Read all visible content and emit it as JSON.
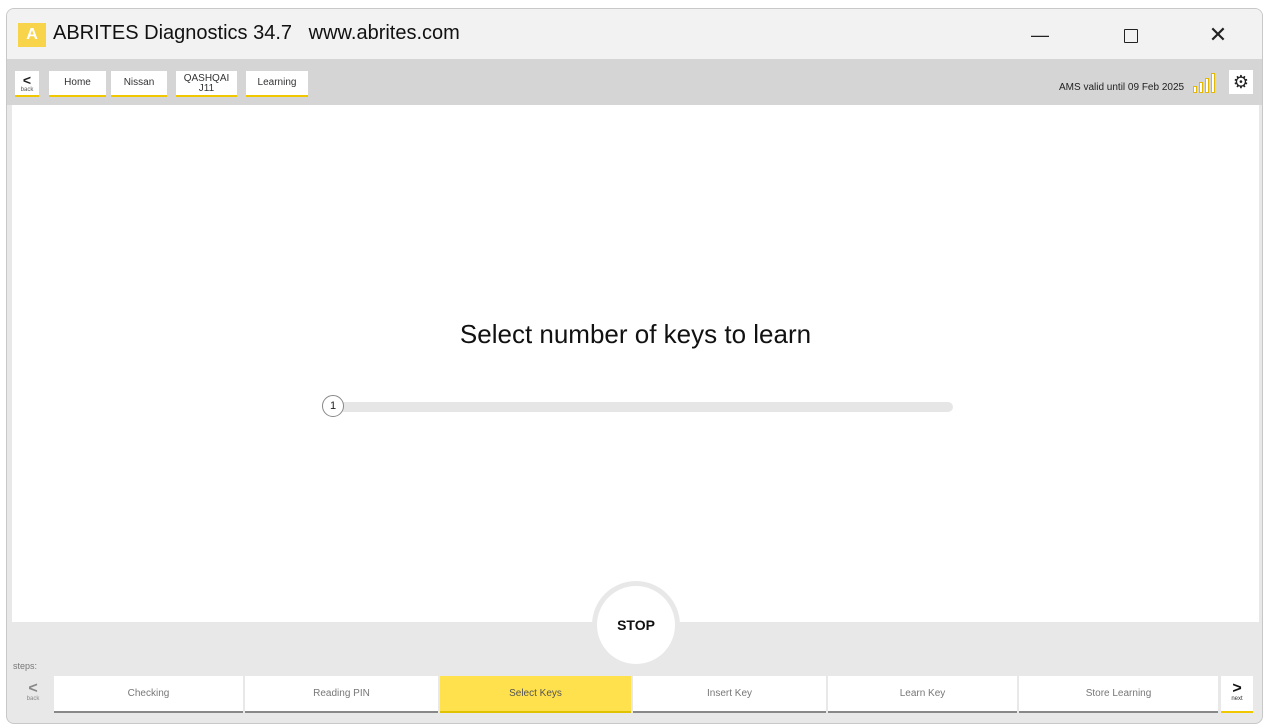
{
  "window": {
    "logo_letter": "A",
    "title": "ABRITES Diagnostics 34.7   www.abrites.com",
    "minimize_glyph": "—",
    "close_glyph": "✕"
  },
  "nav": {
    "back_glyph": "<",
    "back_label": "back",
    "breadcrumbs": {
      "home": "Home",
      "make": "Nissan",
      "model_line1": "QASHQAI",
      "model_line2": "J11",
      "function": "Learning"
    },
    "license_text": "AMS valid until 09 Feb 2025",
    "settings_glyph": "⚙"
  },
  "main": {
    "prompt": "Select number of keys to learn",
    "slider": {
      "value": "1",
      "min": 1
    }
  },
  "stop_label": "STOP",
  "steps": {
    "label": "steps:",
    "back_glyph": "<",
    "back_label": "back",
    "next_glyph": ">",
    "next_label": "next",
    "items": [
      {
        "label": "Checking"
      },
      {
        "label": "Reading PIN"
      },
      {
        "label": "Select Keys"
      },
      {
        "label": "Insert Key"
      },
      {
        "label": "Learn Key"
      },
      {
        "label": "Store Learning"
      }
    ],
    "active_index": 2
  },
  "colors": {
    "accent": "#ffe14d",
    "accent_line": "#f0c800",
    "toolbar_bg": "#d5d5d5",
    "frame_bg": "#e8e8e8"
  }
}
